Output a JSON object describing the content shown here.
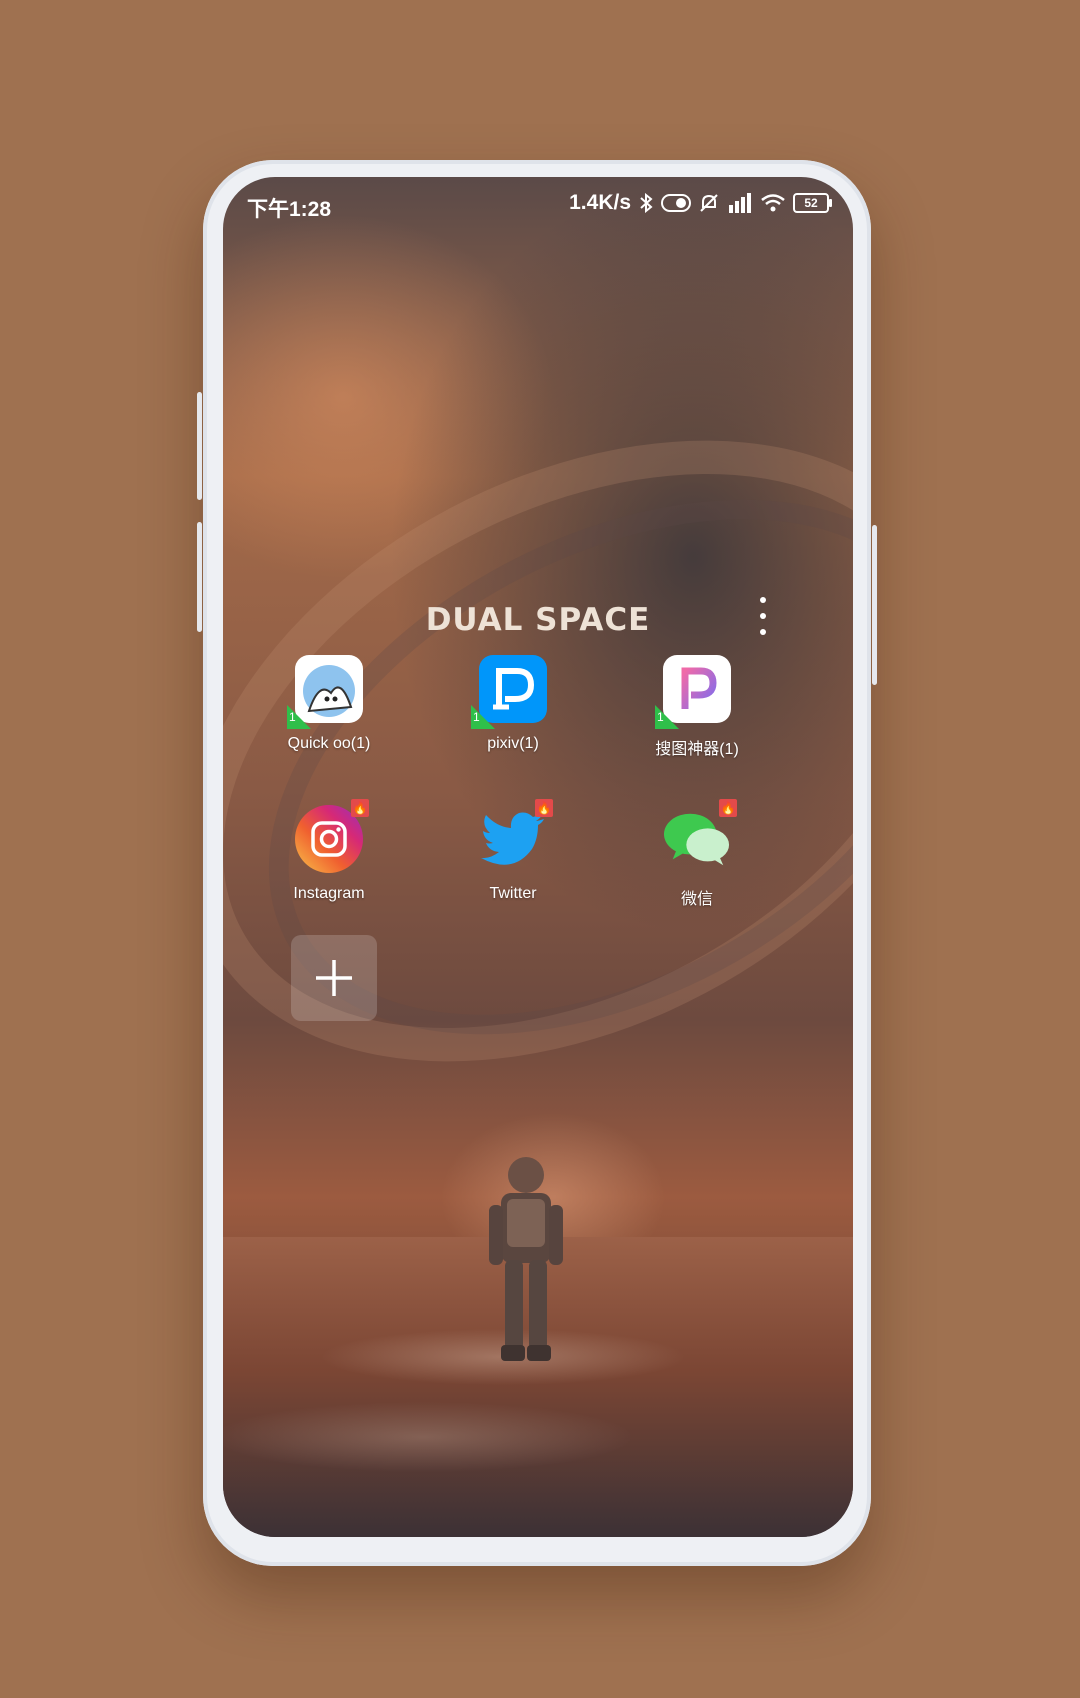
{
  "status_bar": {
    "time": "下午1:28",
    "net_speed": "1.4K/s",
    "battery_level": "52",
    "icons": [
      "bluetooth-icon",
      "toggle-icon",
      "mute-icon",
      "hd-signal-icon",
      "wifi-icon",
      "battery-icon"
    ]
  },
  "header": {
    "brand": "DUAL SPACE",
    "menu_icon": "more-vertical-icon"
  },
  "apps": [
    {
      "label": "Quick oo(1)",
      "badge": "1",
      "icon": "quick-oo-icon"
    },
    {
      "label": "pixiv(1)",
      "badge": "1",
      "icon": "pixiv-icon"
    },
    {
      "label": "搜图神器(1)",
      "badge": "1",
      "icon": "soutu-icon"
    },
    {
      "label": "Instagram",
      "badge": "hot",
      "icon": "instagram-icon"
    },
    {
      "label": "Twitter",
      "badge": "hot",
      "icon": "twitter-icon"
    },
    {
      "label": "微信",
      "badge": "hot",
      "icon": "wechat-icon"
    }
  ],
  "add_button": {
    "icon": "plus-icon"
  },
  "colors": {
    "background": "#9f7150",
    "clone_badge": "#2fbf4a",
    "hot_badge": "#e34a4a",
    "pixiv_blue": "#0096fa",
    "twitter_blue": "#1da1f2",
    "wechat_green": "#3ec94f"
  }
}
